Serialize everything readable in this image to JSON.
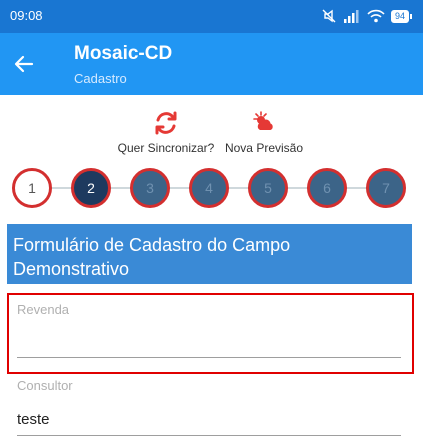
{
  "status_bar": {
    "time": "09:08",
    "battery": "94"
  },
  "app_bar": {
    "title": "Mosaic-CD",
    "subtitle": "Cadastro"
  },
  "actions": {
    "sync_label": "Quer Sincronizar?",
    "forecast_label": "Nova Previsão"
  },
  "stepper": {
    "steps": [
      "1",
      "2",
      "3",
      "4",
      "5",
      "6",
      "7"
    ],
    "current_step": 2
  },
  "form": {
    "header": "Formulário de Cadastro do Campo Demonstrativo",
    "fields": [
      {
        "label": "Revenda",
        "value": ""
      },
      {
        "label": "Consultor",
        "value": "teste"
      }
    ]
  },
  "colors": {
    "status_bar": "#1976d2",
    "app_bar": "#2196f3",
    "form_header": "#3a8ad6",
    "step_border": "#d32f2f",
    "step_current": "#1e3a5f",
    "highlight": "#e00000"
  }
}
